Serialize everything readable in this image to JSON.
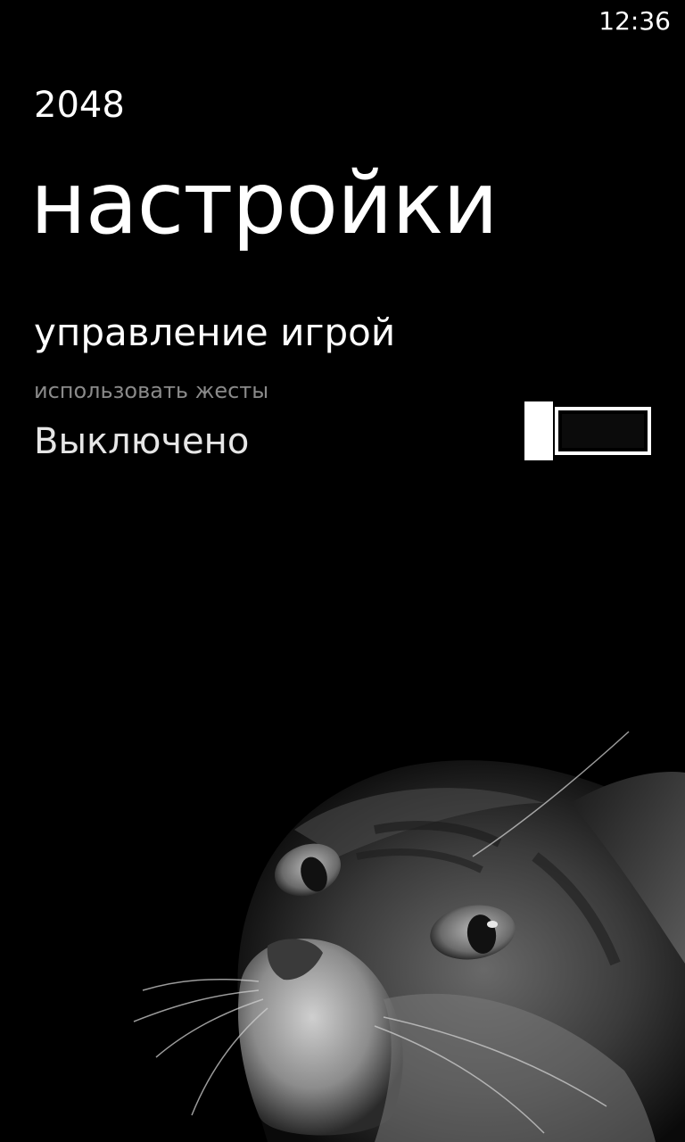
{
  "status_bar": {
    "time": "12:36"
  },
  "header": {
    "app_name": "2048",
    "page_title": "настройки"
  },
  "settings": {
    "section_header": "управление игрой",
    "gestures_toggle": {
      "label": "использовать жесты",
      "state_text": "Выключено",
      "is_on": false
    }
  },
  "background": {
    "image": "cat-photo",
    "tone": "grayscale"
  },
  "colors": {
    "background": "#000000",
    "text": "#ffffff",
    "subtle_text": "#8a8a8a"
  }
}
